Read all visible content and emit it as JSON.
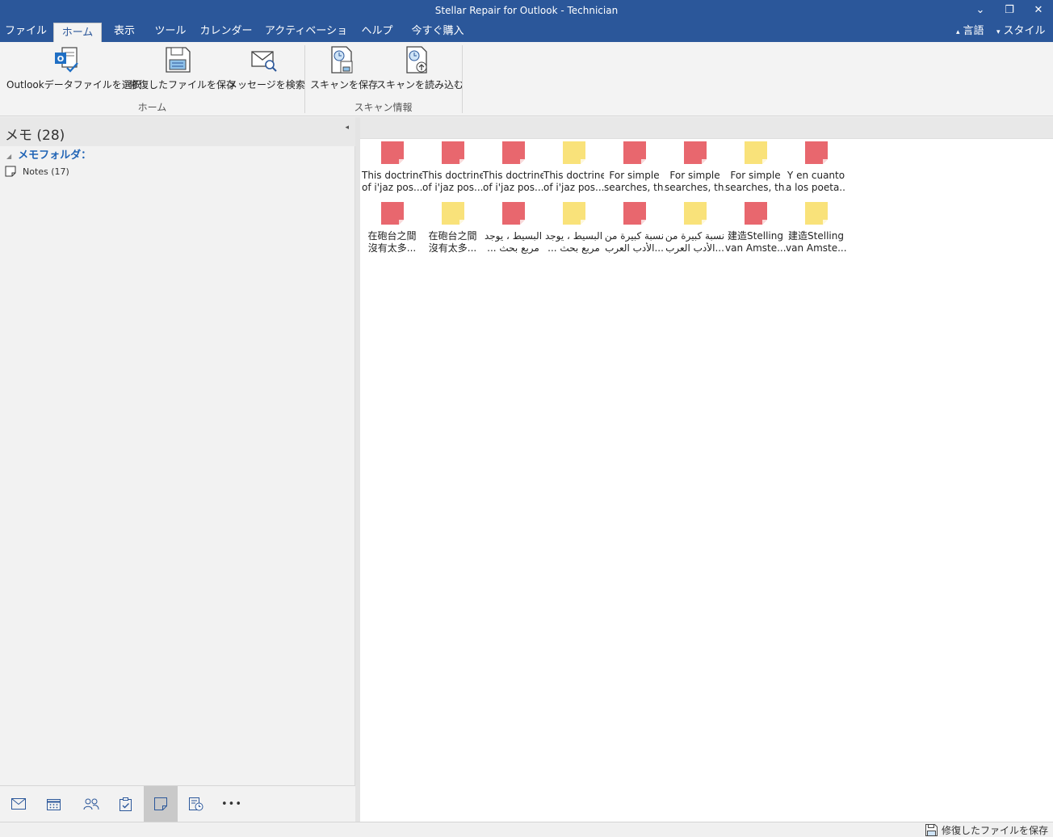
{
  "window": {
    "title": "Stellar Repair for Outlook - Technician",
    "minimize": "⌄",
    "restore": "❐",
    "close": "✕"
  },
  "menu": {
    "items": [
      "ファイル",
      "ホーム",
      "表示",
      "ツール",
      "カレンダー",
      "アクティベーション",
      "ヘルプ",
      "今すぐ購入"
    ],
    "active": "ホーム",
    "language": "言語",
    "style": "スタイル",
    "language_caret": "▴",
    "style_caret": "▾"
  },
  "ribbon": {
    "buttons": {
      "select_pst": "Outlookデータファイルを選択",
      "save_repaired": "修復したファイルを保存",
      "find_message": "メッセージを検索",
      "save_scan": "スキャンを保存",
      "load_scan": "スキャンを読み込む"
    },
    "groups": {
      "home": "ホーム",
      "scan_info": "スキャン情報"
    },
    "accent": "#2b579a"
  },
  "left_pane": {
    "title": "メモ (28)",
    "collapse": "◂",
    "folder_tri": "◢",
    "folder_heading": "メモフォルダ：",
    "folder_item": "Notes (17)",
    "nav_more": "•••"
  },
  "notes": [
    {
      "line1": "This doctrine",
      "line2": "of i'jaz pos...",
      "color": "red"
    },
    {
      "line1": "This doctrine",
      "line2": "of i'jaz pos...",
      "color": "red"
    },
    {
      "line1": "This doctrine",
      "line2": "of i'jaz pos...",
      "color": "red"
    },
    {
      "line1": "This doctrine",
      "line2": "of i'jaz pos...",
      "color": "yellow"
    },
    {
      "line1": "For simple",
      "line2": "searches, th...",
      "color": "red"
    },
    {
      "line1": "For simple",
      "line2": "searches, th...",
      "color": "red"
    },
    {
      "line1": "For simple",
      "line2": "searches, th...",
      "color": "yellow"
    },
    {
      "line1": "Y en cuanto",
      "line2": "a los poeta...",
      "color": "red"
    },
    {
      "line1": "在砲台之間",
      "line2": "沒有太多...",
      "color": "red"
    },
    {
      "line1": "在砲台之間",
      "line2": "沒有太多...",
      "color": "yellow"
    },
    {
      "line1": "البسيط ، يوجد",
      "line2": "... مربع بحث",
      "color": "red"
    },
    {
      "line1": "البسيط ، يوجد",
      "line2": "... مربع بحث",
      "color": "yellow"
    },
    {
      "line1": "نسبة كبيرة من",
      "line2": "الأدب العرب...",
      "color": "red"
    },
    {
      "line1": "نسبة كبيرة من",
      "line2": "الأدب العرب...",
      "color": "yellow"
    },
    {
      "line1": "建造Stelling",
      "line2": "van Amste...",
      "color": "red"
    },
    {
      "line1": "建造Stelling",
      "line2": "van Amste...",
      "color": "yellow"
    }
  ],
  "colors": {
    "red": "#e8676e",
    "yellow": "#f9e27a"
  },
  "status": {
    "save_label": "修復したファイルを保存"
  }
}
